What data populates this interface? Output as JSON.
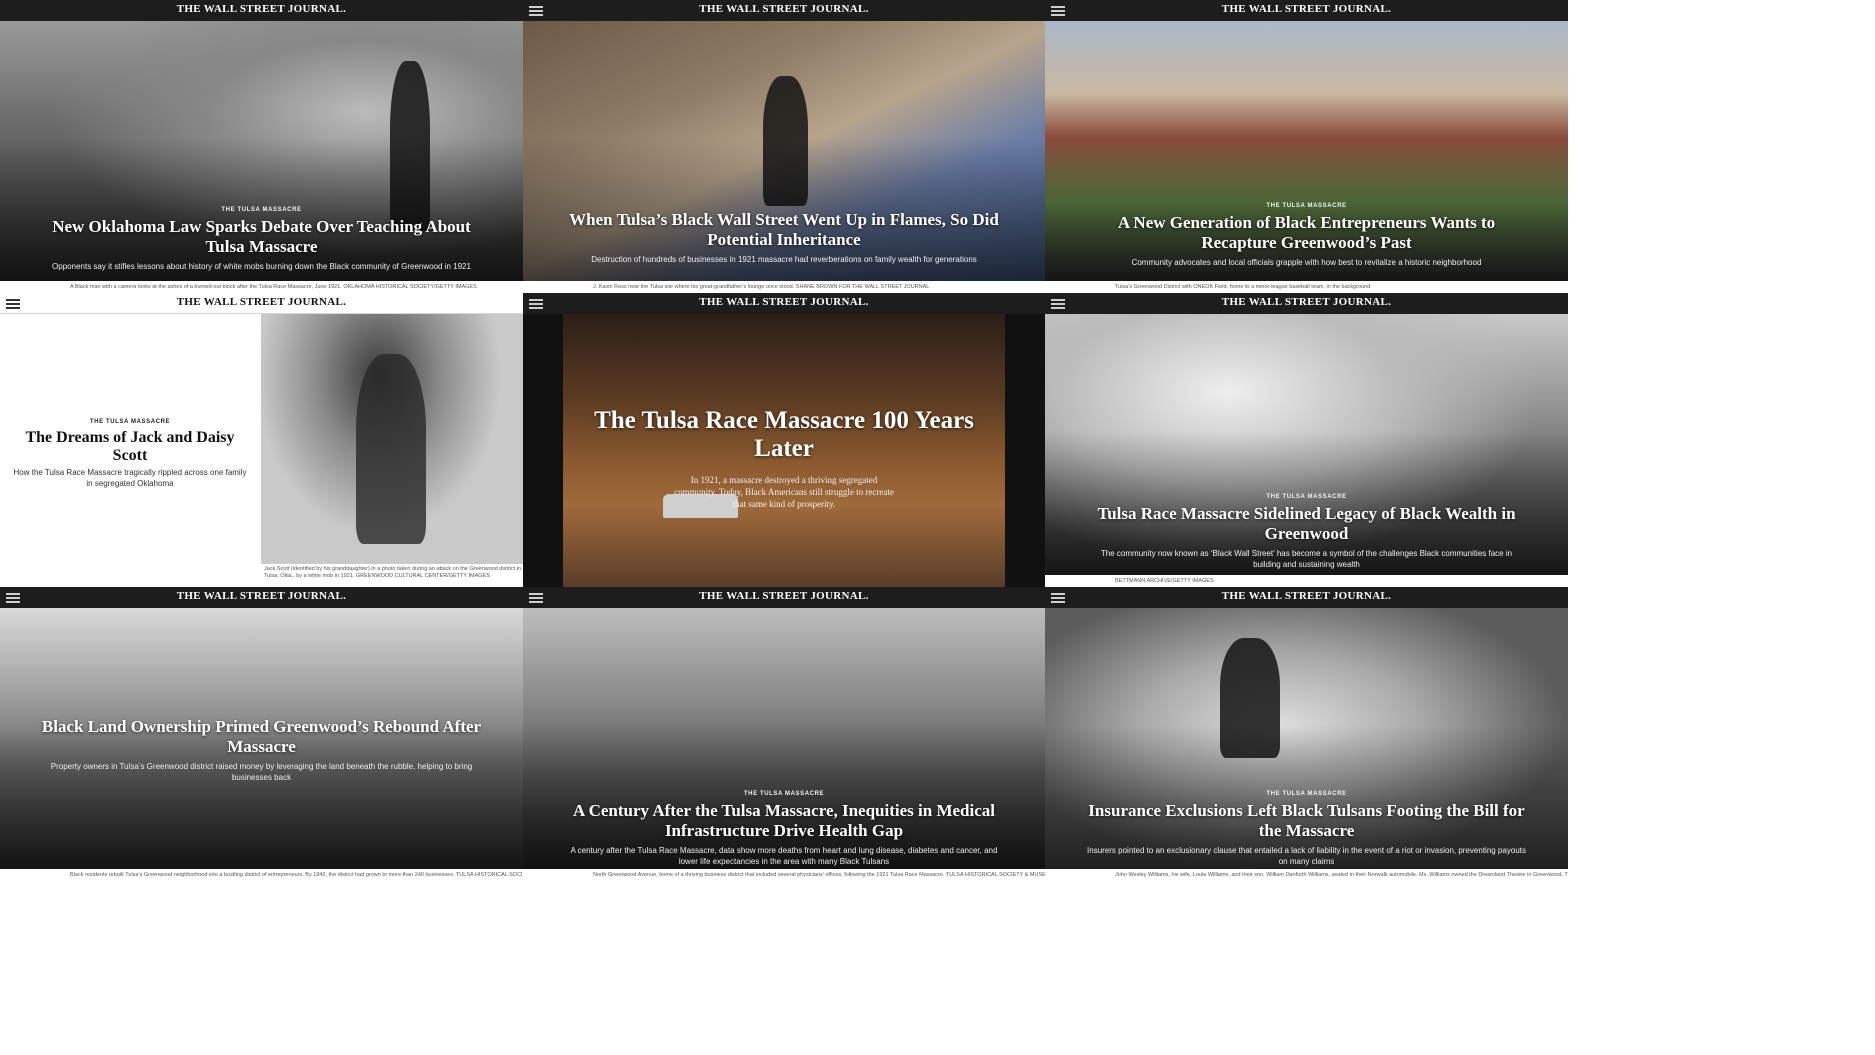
{
  "masthead": "THE WALL STREET JOURNAL.",
  "panels": [
    {
      "kicker": "THE TULSA MASSACRE",
      "headline": "New Oklahoma Law Sparks Debate Over Teaching About Tulsa Massacre",
      "dek": "Opponents say it stifles lessons about history of white mobs burning down the Black community of Greenwood in 1921",
      "credit": "A Black man with a camera looks at the ashes of a burned-out block after the Tulsa Race Massacre, June 1921. OKLAHOMA HISTORICAL SOCIETY/GETTY IMAGES"
    },
    {
      "kicker": "",
      "headline": "When Tulsa’s Black Wall Street Went Up in Flames, So Did Potential Inheritance",
      "dek": "Destruction of hundreds of businesses in 1921 massacre had reverberations on family wealth for generations",
      "credit": "J. Kavin Ross near the Tulsa site where his great-grandfather’s lounge once stood. SHANE BROWN FOR THE WALL STREET JOURNAL"
    },
    {
      "kicker": "THE TULSA MASSACRE",
      "headline": "A New Generation of Black Entrepreneurs Wants to Recapture Greenwood’s Past",
      "dek": "Community advocates and local officials grapple with how best to revitalize a historic neighborhood",
      "credit": "Tulsa’s Greenwood District with ONEOK Field, home to a minor-league baseball team, in the background"
    },
    {
      "kicker": "THE TULSA MASSACRE",
      "headline": "The Dreams of Jack and Daisy Scott",
      "dek": "How the Tulsa Race Massacre tragically rippled across one family in segregated Oklahoma",
      "credit": "Jack Scott (identified by his granddaughter) in a photo taken during an attack on the Greenwood district in Tulsa, Okla., by a white mob in 1921. GREENWOOD CULTURAL CENTER/GETTY IMAGES"
    },
    {
      "kicker": "",
      "headline": "The Tulsa Race Massacre 100 Years Later",
      "dek": "In 1921, a massacre destroyed a thriving segregated community. Today, Black Americans still struggle to recreate that same kind of prosperity.",
      "credit": ""
    },
    {
      "kicker": "THE TULSA MASSACRE",
      "headline": "Tulsa Race Massacre Sidelined Legacy of Black Wealth in Greenwood",
      "dek": "The community now known as ‘Black Wall Street’ has become a symbol of the challenges Black communities face in building and sustaining wealth",
      "credit": "BETTMANN ARCHIVE/GETTY IMAGES"
    },
    {
      "kicker": "",
      "headline": "Black Land Ownership Primed Greenwood’s Rebound After Massacre",
      "dek": "Property owners in Tulsa’s Greenwood district raised money by leveraging the land beneath the rubble, helping to bring businesses back",
      "credit": "Black residents rebuilt Tulsa’s Greenwood neighborhood into a bustling district of entrepreneurs. By 1942, the district had grown to more than 240 businesses. TULSA HISTORICAL SOCIETY & MUSEUM"
    },
    {
      "kicker": "THE TULSA MASSACRE",
      "headline": "A Century After the Tulsa Massacre, Inequities in Medical Infrastructure Drive Health Gap",
      "dek": "A century after the Tulsa Race Massacre, data show more deaths from heart and lung disease, diabetes and cancer, and lower life expectancies in the area with many Black Tulsans",
      "credit": "North Greenwood Avenue, home of a thriving business district that included several physicians’ offices, following the 1921 Tulsa Race Massacre. TULSA HISTORICAL SOCIETY & MUSEUM"
    },
    {
      "kicker": "THE TULSA MASSACRE",
      "headline": "Insurance Exclusions Left Black Tulsans Footing the Bill for the Massacre",
      "dek": "Insurers pointed to an exclusionary clause that entailed a lack of liability in the event of a riot or invasion, preventing payouts on many claims",
      "credit": "John Wesley Williams, his wife, Loula Williams, and their son, William Danforth Williams, seated in their Norwalk automobile. Ms. Williams owned the Dreamland Theatre in Greenwood. TULSA HISTORICAL"
    }
  ]
}
